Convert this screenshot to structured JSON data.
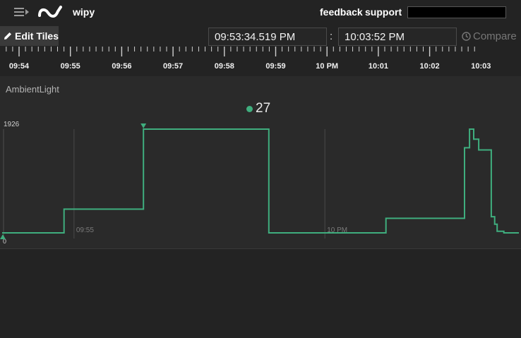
{
  "header": {
    "device_name": "wipy",
    "feedback_label": "feedback",
    "support_label": "support"
  },
  "toolbar": {
    "edit_tiles_label": "Edit Tiles",
    "time_from": "09:53:34.519 PM",
    "time_to": "10:03:52 PM",
    "separator": ":",
    "compare_label": "Compare"
  },
  "timeline": {
    "labels": [
      "09:54",
      "09:55",
      "09:56",
      "09:57",
      "09:58",
      "09:59",
      "10 PM",
      "10:01",
      "10:02",
      "10:03"
    ]
  },
  "colors": {
    "accent": "#3fae7e",
    "background": "#232323",
    "tile_background": "#2a2a2a"
  },
  "tile": {
    "title": "AmbientLight",
    "current_value": "27",
    "ymax_label": "1926",
    "ymin_label": "0",
    "grid_labels": [
      "09:55",
      "10 PM"
    ]
  },
  "chart_data": {
    "type": "line",
    "title": "AmbientLight",
    "ylim": [
      0,
      1926
    ],
    "x_unit": "seconds after 09:53:34 PM",
    "xlim": [
      0,
      618
    ],
    "x_grid_ticks": [
      {
        "label": "09:55",
        "x": 86
      },
      {
        "label": "10 PM",
        "x": 386
      }
    ],
    "series": [
      {
        "points": [
          [
            0,
            0
          ],
          [
            74,
            0
          ],
          [
            74,
            440
          ],
          [
            169,
            440
          ],
          [
            169,
            1926
          ],
          [
            319,
            1926
          ],
          [
            319,
            0
          ],
          [
            459,
            0
          ],
          [
            459,
            270
          ],
          [
            553,
            270
          ],
          [
            553,
            1580
          ],
          [
            559,
            1580
          ],
          [
            559,
            1926
          ],
          [
            564,
            1926
          ],
          [
            564,
            1740
          ],
          [
            570,
            1740
          ],
          [
            570,
            1540
          ],
          [
            585,
            1540
          ],
          [
            585,
            300
          ],
          [
            589,
            300
          ],
          [
            589,
            160
          ],
          [
            592,
            160
          ],
          [
            592,
            30
          ],
          [
            600,
            30
          ],
          [
            600,
            0
          ],
          [
            618,
            0
          ]
        ]
      }
    ]
  }
}
